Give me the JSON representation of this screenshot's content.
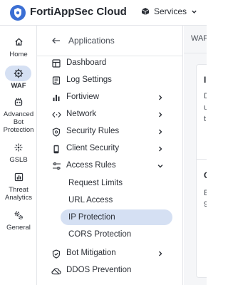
{
  "header": {
    "app_title": "FortiAppSec Cloud",
    "services_label": "Services",
    "logo_icon": "fortiappsec-logo-icon",
    "brand_color": "#3b6fd4"
  },
  "rail": {
    "items": [
      {
        "label": "Home",
        "icon": "home-icon"
      },
      {
        "label": "WAF",
        "icon": "waf-icon",
        "active": true
      },
      {
        "label": "Advanced Bot Protection",
        "lines": [
          "Advanced",
          "Bot",
          "Protection"
        ],
        "icon": "bot-icon"
      },
      {
        "label": "GSLB",
        "icon": "gslb-icon"
      },
      {
        "label": "Threat Analytics",
        "lines": [
          "Threat",
          "Analytics"
        ],
        "icon": "chart-icon"
      },
      {
        "label": "General",
        "icon": "gears-icon"
      }
    ]
  },
  "menu": {
    "back_label": "Applications",
    "items": [
      {
        "label": "Dashboard",
        "icon": "dashboard-icon"
      },
      {
        "label": "Log Settings",
        "icon": "log-icon"
      },
      {
        "label": "Fortiview",
        "icon": "bar-chart-icon",
        "chevron": "right"
      },
      {
        "label": "Network",
        "icon": "network-icon",
        "chevron": "right"
      },
      {
        "label": "Security Rules",
        "icon": "shield-icon",
        "chevron": "right"
      },
      {
        "label": "Client Security",
        "icon": "phone-icon",
        "chevron": "right"
      },
      {
        "label": "Access Rules",
        "icon": "sliders-icon",
        "chevron": "down"
      },
      {
        "label": "Bot Mitigation",
        "icon": "shield-check-icon",
        "chevron": "right"
      },
      {
        "label": "DDOS Prevention",
        "icon": "cloud-icon"
      }
    ],
    "access_rules_sub": [
      {
        "label": "Request Limits"
      },
      {
        "label": "URL Access"
      },
      {
        "label": "IP Protection",
        "active": true
      },
      {
        "label": "CORS Protection"
      }
    ]
  },
  "content": {
    "breadcrumb": "WAF",
    "fragments": [
      "I",
      "D",
      "u",
      "t",
      "C",
      "E",
      "9"
    ]
  },
  "colors": {
    "active_bg": "#d5e0f3",
    "text": "#2b2f36",
    "border": "#e4e6ea"
  }
}
